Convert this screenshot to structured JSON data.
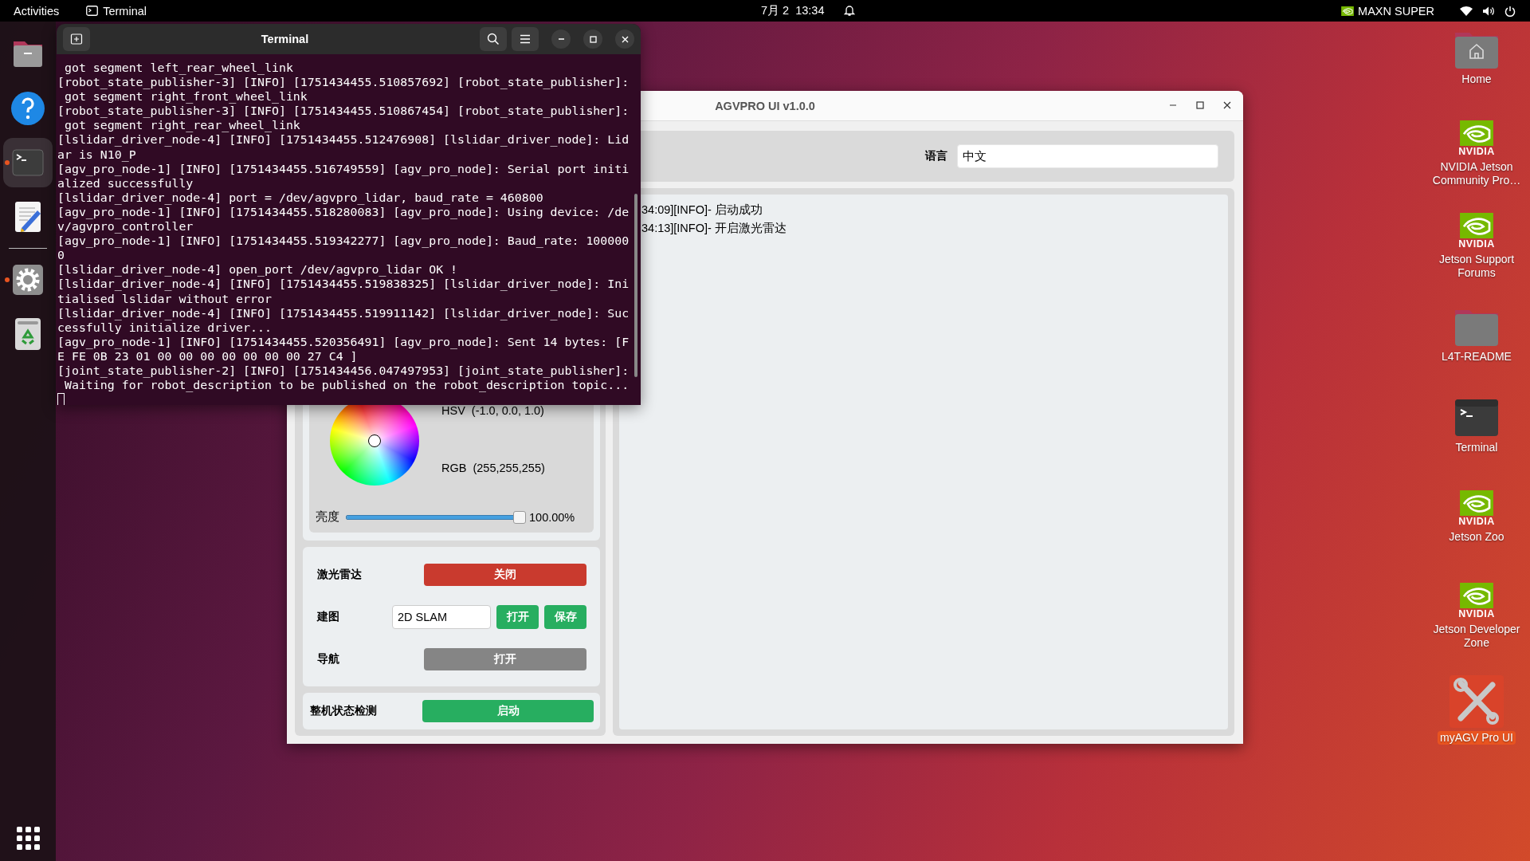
{
  "top_bar": {
    "activities": "Activities",
    "app": "Terminal",
    "clock": "7月 2  13:34",
    "power_mode": "MAXN SUPER"
  },
  "dock": {
    "items": [
      {
        "kind": "files",
        "running": false,
        "focused": false
      },
      {
        "kind": "help",
        "running": false,
        "focused": false
      },
      {
        "kind": "terminal",
        "running": true,
        "focused": true
      },
      {
        "kind": "editor",
        "running": false,
        "focused": false
      },
      {
        "kind": "settings",
        "running": true,
        "focused": false
      },
      {
        "kind": "trash",
        "running": false,
        "focused": false
      }
    ]
  },
  "terminal": {
    "title": "Terminal",
    "lines": [
      " got segment left_rear_wheel_link",
      "[robot_state_publisher-3] [INFO] [1751434455.510857692] [robot_state_publisher]:",
      " got segment right_front_wheel_link",
      "[robot_state_publisher-3] [INFO] [1751434455.510867454] [robot_state_publisher]:",
      " got segment right_rear_wheel_link",
      "[lslidar_driver_node-4] [INFO] [1751434455.512476908] [lslidar_driver_node]: Lid",
      "ar is N10_P",
      "[agv_pro_node-1] [INFO] [1751434455.516749559] [agv_pro_node]: Serial port initi",
      "alized successfully",
      "[lslidar_driver_node-4] port = /dev/agvpro_lidar, baud_rate = 460800",
      "[agv_pro_node-1] [INFO] [1751434455.518280083] [agv_pro_node]: Using device: /de",
      "v/agvpro_controller",
      "[agv_pro_node-1] [INFO] [1751434455.519342277] [agv_pro_node]: Baud_rate: 100000",
      "0",
      "[lslidar_driver_node-4] open_port /dev/agvpro_lidar OK !",
      "[lslidar_driver_node-4] [INFO] [1751434455.519838325] [lslidar_driver_node]: Ini",
      "tialised lslidar without error",
      "[lslidar_driver_node-4] [INFO] [1751434455.519911142] [lslidar_driver_node]: Suc",
      "cessfully initialize driver...",
      "[agv_pro_node-1] [INFO] [1751434455.520356491] [agv_pro_node]: Sent 14 bytes: [F",
      "E FE 0B 23 01 00 00 00 00 00 00 00 27 C4 ]",
      "[joint_state_publisher-2] [INFO] [1751434456.047497953] [joint_state_publisher]:",
      " Waiting for robot_description to be published on the robot_description topic..."
    ]
  },
  "agvpro_window": {
    "title": "AGVPRO UI v1.0.0",
    "language_label": "语言",
    "language_value": "中文",
    "color": {
      "hsv": "HSV  (-1.0, 0.0, 1.0)",
      "rgb": "RGB  (255,255,255)",
      "brightness_label": "亮度",
      "brightness": {
        "level": 1
      },
      "brightness_reading": "100.00%"
    },
    "controls": [
      {
        "label": "激光雷达",
        "buttons": [
          {
            "label": "关闭",
            "kind": "stop",
            "disabled": false
          }
        ]
      },
      {
        "label": "建图",
        "field": "2D SLAM",
        "buttons": [
          {
            "label": "打开",
            "kind": "start",
            "disabled": false
          },
          {
            "label": "保存",
            "kind": "start",
            "disabled": false
          }
        ]
      },
      {
        "label": "导航",
        "buttons": [
          {
            "label": "打开",
            "kind": "start",
            "disabled": true
          }
        ]
      }
    ],
    "health_check": {
      "label": "整机状态检测",
      "button": {
        "label": "启动",
        "kind": "start",
        "disabled": false
      }
    },
    "log": [
      "34:09][INFO]- 启动成功",
      "34:13][INFO]- 开启激光雷达"
    ]
  },
  "desktop_icons": [
    {
      "kind": "home",
      "label": "Home",
      "selected": false
    },
    {
      "kind": "nvidia",
      "logo_text": "NVIDIA",
      "label": "NVIDIA Jetson Community Pro…",
      "selected": false
    },
    {
      "kind": "nvidia",
      "logo_text": "NVIDIA",
      "label": "Jetson Support Forums",
      "selected": false
    },
    {
      "kind": "folder",
      "label": "L4T-README",
      "selected": false
    },
    {
      "kind": "terminal",
      "label": "Terminal",
      "selected": false
    },
    {
      "kind": "nvidia",
      "logo_text": "NVIDIA",
      "label": "Jetson Zoo",
      "selected": false
    },
    {
      "kind": "nvidia",
      "logo_text": "NVIDIA",
      "label": "Jetson Developer Zone",
      "selected": false
    },
    {
      "kind": "tools",
      "label": "myAGV Pro UI",
      "selected": true
    }
  ]
}
